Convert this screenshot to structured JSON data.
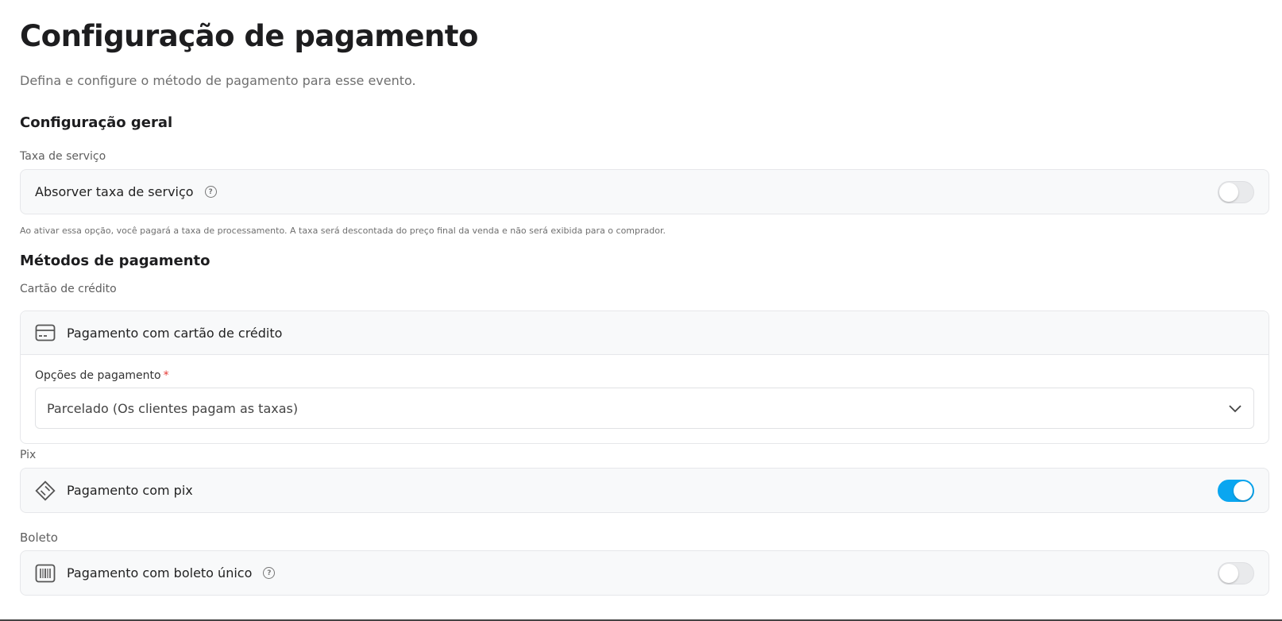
{
  "header": {
    "title": "Configuração de pagamento",
    "subtitle": "Defina e configure o método de pagamento para esse evento."
  },
  "general": {
    "section_title": "Configuração geral",
    "service_fee_label": "Taxa de serviço",
    "absorb_label": "Absorver taxa de serviço",
    "absorb_enabled": false,
    "hint": "Ao ativar essa opção, você pagará a taxa de processamento. A taxa será descontada do preço final da venda e não será exibida para o comprador."
  },
  "methods": {
    "section_title": "Métodos de pagamento",
    "credit_card": {
      "group_label": "Cartão de crédito",
      "title": "Pagamento com cartão de crédito",
      "icon": "credit-card-icon",
      "options_label": "Opções de pagamento",
      "required_mark": "*",
      "selected_option": "Parcelado (Os clientes pagam as taxas)"
    },
    "pix": {
      "group_label": "Pix",
      "title": "Pagamento com pix",
      "icon": "pix-icon",
      "enabled": true
    },
    "boleto": {
      "group_label": "Boleto",
      "title": "Pagamento com boleto único",
      "icon": "barcode-icon",
      "enabled": false
    }
  },
  "colors": {
    "toggle_on": "#0aa6f0",
    "required": "#e53935"
  }
}
